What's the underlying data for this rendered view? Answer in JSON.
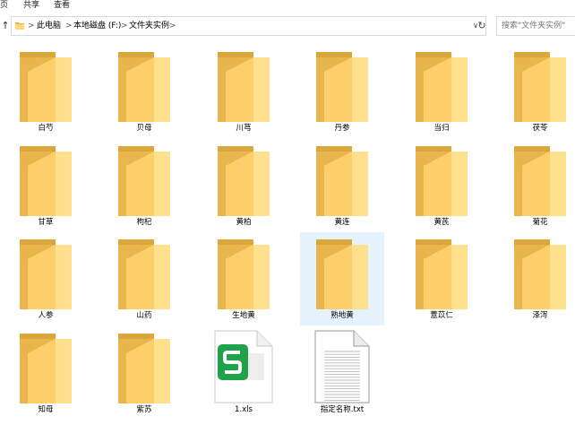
{
  "menu": {
    "tab_view_partial": "页",
    "tab_share": "共享",
    "tab_view": "查看"
  },
  "nav": {
    "up_icon": "↑",
    "breadcrumb": [
      "此电脑",
      "本地磁盘 (F:)",
      "文件夹实例"
    ],
    "separator": ">",
    "dropdown_icon": "∨",
    "refresh_icon": "↻",
    "search_placeholder": "搜索\"文件夹实例\""
  },
  "items": [
    {
      "label": "白芍",
      "type": "folder"
    },
    {
      "label": "贝母",
      "type": "folder"
    },
    {
      "label": "川芎",
      "type": "folder"
    },
    {
      "label": "丹参",
      "type": "folder"
    },
    {
      "label": "当归",
      "type": "folder"
    },
    {
      "label": "茯苓",
      "type": "folder"
    },
    {
      "label": "甘草",
      "type": "folder"
    },
    {
      "label": "枸杞",
      "type": "folder"
    },
    {
      "label": "黄柏",
      "type": "folder"
    },
    {
      "label": "黄连",
      "type": "folder"
    },
    {
      "label": "黄芪",
      "type": "folder"
    },
    {
      "label": "菊花",
      "type": "folder"
    },
    {
      "label": "人参",
      "type": "folder"
    },
    {
      "label": "山药",
      "type": "folder"
    },
    {
      "label": "生地黄",
      "type": "folder"
    },
    {
      "label": "熟地黄",
      "type": "folder",
      "selected": true
    },
    {
      "label": "薏苡仁",
      "type": "folder"
    },
    {
      "label": "泽泻",
      "type": "folder"
    },
    {
      "label": "知母",
      "type": "folder"
    },
    {
      "label": "紫苏",
      "type": "folder"
    },
    {
      "label": "1.xls",
      "type": "xls-file"
    },
    {
      "label": "指定名称.txt",
      "type": "txt-file"
    }
  ],
  "colors": {
    "folder_back": "#E8B64C",
    "folder_front": "#FFD978",
    "selection": "#E5F3FF",
    "xls_green": "#1FA34A"
  }
}
